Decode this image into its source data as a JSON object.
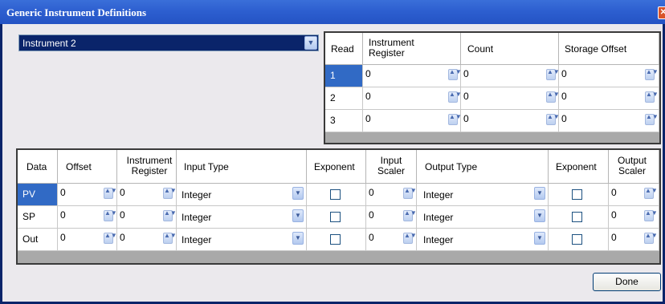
{
  "window": {
    "title": "Generic Instrument Definitions",
    "close_glyph": "✕"
  },
  "instrument_select": {
    "value": "Instrument 2",
    "arrow": "▼"
  },
  "read_table": {
    "headers": [
      "Read",
      "Instrument Register",
      "Count",
      "Storage Offset"
    ],
    "rows": [
      {
        "read": "1",
        "register": "0",
        "count": "0",
        "offset": "0"
      },
      {
        "read": "2",
        "register": "0",
        "count": "0",
        "offset": "0"
      },
      {
        "read": "3",
        "register": "0",
        "count": "0",
        "offset": "0"
      }
    ]
  },
  "data_table": {
    "headers": [
      "Data",
      "Offset",
      "Instrument Register",
      "Input Type",
      "Exponent",
      "Input Scaler",
      "Output Type",
      "Exponent",
      "Output Scaler"
    ],
    "rows": [
      {
        "data": "PV",
        "offset": "0",
        "register": "0",
        "input_type": "Integer",
        "input_scaler": "0",
        "output_type": "Integer",
        "output_scaler": "0"
      },
      {
        "data": "SP",
        "offset": "0",
        "register": "0",
        "input_type": "Integer",
        "input_scaler": "0",
        "output_type": "Integer",
        "output_scaler": "0"
      },
      {
        "data": "Out",
        "offset": "0",
        "register": "0",
        "input_type": "Integer",
        "input_scaler": "0",
        "output_type": "Integer",
        "output_scaler": "0"
      }
    ]
  },
  "buttons": {
    "done": "Done"
  },
  "icons": {
    "spin": "spinner-updown-icon",
    "dropdown": "chevron-down-icon",
    "close": "close-icon"
  },
  "colors": {
    "selection": "#316ac5",
    "titlebar": "#2d5fd0",
    "dialog_bg": "#ebe9ed"
  }
}
